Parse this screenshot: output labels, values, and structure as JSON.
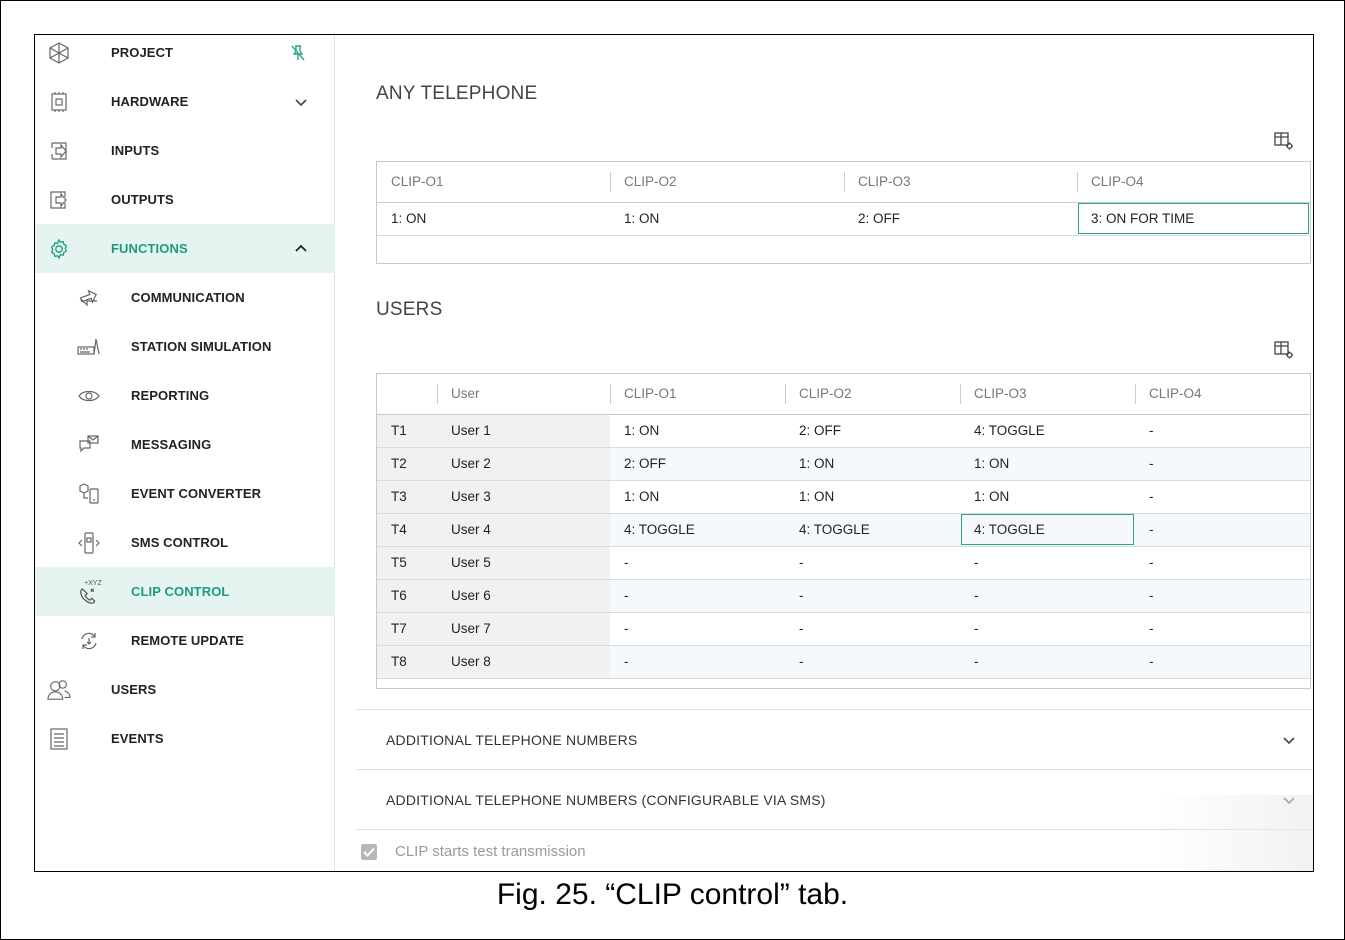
{
  "sidebar": {
    "items": [
      {
        "label": "PROJECT",
        "icon": "project-icon"
      },
      {
        "label": "HARDWARE",
        "icon": "hardware-icon"
      },
      {
        "label": "INPUTS",
        "icon": "inputs-icon"
      },
      {
        "label": "OUTPUTS",
        "icon": "outputs-icon"
      },
      {
        "label": "FUNCTIONS",
        "icon": "gear-icon"
      },
      {
        "label": "COMMUNICATION",
        "icon": "communication-icon"
      },
      {
        "label": "STATION SIMULATION",
        "icon": "station-simulation-icon"
      },
      {
        "label": "REPORTING",
        "icon": "eye-icon"
      },
      {
        "label": "MESSAGING",
        "icon": "messaging-icon"
      },
      {
        "label": "EVENT CONVERTER",
        "icon": "event-converter-icon"
      },
      {
        "label": "SMS CONTROL",
        "icon": "sms-control-icon"
      },
      {
        "label": "CLIP CONTROL",
        "icon": "clip-control-icon"
      },
      {
        "label": "REMOTE UPDATE",
        "icon": "remote-update-icon"
      },
      {
        "label": "USERS",
        "icon": "users-icon"
      },
      {
        "label": "EVENTS",
        "icon": "events-icon"
      }
    ],
    "active": "CLIP CONTROL",
    "clip_icon_text": "+XYZ"
  },
  "any_telephone": {
    "title": "ANY TELEPHONE",
    "columns": [
      "CLIP-O1",
      "CLIP-O2",
      "CLIP-O3",
      "CLIP-O4"
    ],
    "row": [
      "1: ON",
      "1: ON",
      "2: OFF",
      "3: ON FOR TIME"
    ]
  },
  "users": {
    "title": "USERS",
    "columns": [
      "",
      "User",
      "CLIP-O1",
      "CLIP-O2",
      "CLIP-O3",
      "CLIP-O4"
    ],
    "rows": [
      [
        "T1",
        "User 1",
        "1: ON",
        "2: OFF",
        "4: TOGGLE",
        "-"
      ],
      [
        "T2",
        "User 2",
        "2: OFF",
        "1: ON",
        "1: ON",
        "-"
      ],
      [
        "T3",
        "User 3",
        "1: ON",
        "1: ON",
        "1: ON",
        "-"
      ],
      [
        "T4",
        "User 4",
        "4: TOGGLE",
        "4: TOGGLE",
        "4: TOGGLE",
        "-"
      ],
      [
        "T5",
        "User 5",
        "-",
        "-",
        "-",
        "-"
      ],
      [
        "T6",
        "User 6",
        "-",
        "-",
        "-",
        "-"
      ],
      [
        "T7",
        "User 7",
        "-",
        "-",
        "-",
        "-"
      ],
      [
        "T8",
        "User 8",
        "-",
        "-",
        "-",
        "-"
      ]
    ]
  },
  "accordions": [
    {
      "label": "ADDITIONAL TELEPHONE NUMBERS"
    },
    {
      "label": "ADDITIONAL TELEPHONE NUMBERS (CONFIGURABLE VIA SMS)"
    }
  ],
  "checkbox": {
    "label": "CLIP starts test transmission",
    "checked": true
  },
  "caption": "Fig. 25. “CLIP control” tab.",
  "colors": {
    "accent": "#1b9c82",
    "active_bg": "#e6f4f1"
  }
}
